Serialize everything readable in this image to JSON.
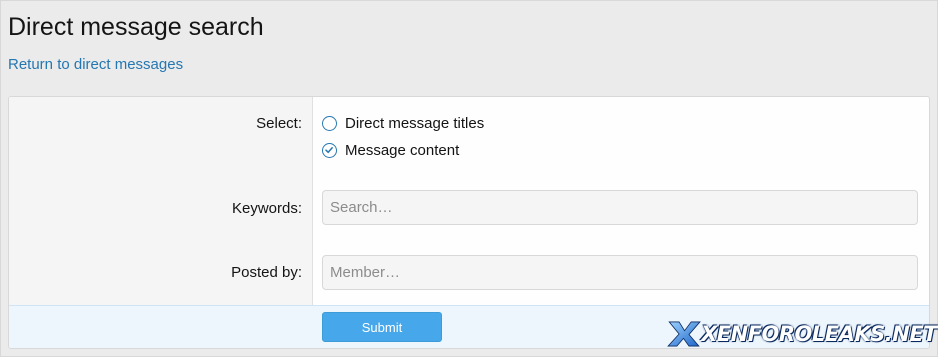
{
  "page": {
    "title": "Direct message search",
    "back_link": "Return to direct messages"
  },
  "form": {
    "select_label": "Select:",
    "options": [
      {
        "label": "Direct message titles",
        "checked": false
      },
      {
        "label": "Message content",
        "checked": true
      }
    ],
    "keywords_label": "Keywords:",
    "keywords_placeholder": "Search…",
    "keywords_value": "",
    "posted_by_label": "Posted by:",
    "posted_by_placeholder": "Member…",
    "posted_by_value": "",
    "submit_label": "Submit"
  },
  "watermark": {
    "text": "XENFOROLEAKS.NET"
  },
  "colors": {
    "accent": "#2577b1",
    "button": "#47a7eb",
    "footer_bg": "#edf6fd",
    "page_bg": "#ebebeb"
  }
}
